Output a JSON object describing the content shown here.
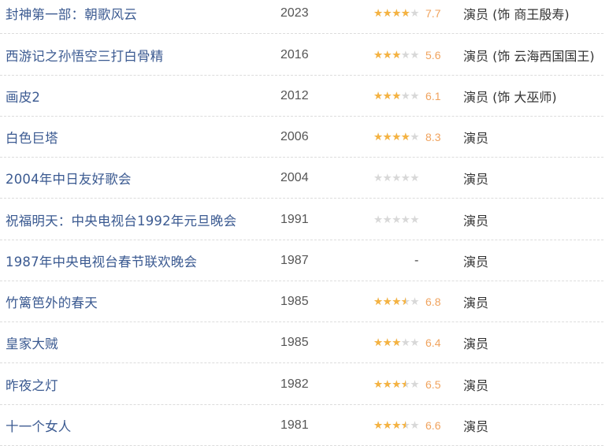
{
  "filmography": {
    "rows": [
      {
        "title": "封神第一部：朝歌风云",
        "year": "2023",
        "rating": 7.7,
        "score": "7.7",
        "role": "演员 (饰 商王殷寿)"
      },
      {
        "title": "西游记之孙悟空三打白骨精",
        "year": "2016",
        "rating": 5.6,
        "score": "5.6",
        "role": "演员 (饰 云海西国国王)"
      },
      {
        "title": "画皮2",
        "year": "2012",
        "rating": 6.1,
        "score": "6.1",
        "role": "演员 (饰 大巫师)"
      },
      {
        "title": "白色巨塔",
        "year": "2006",
        "rating": 8.3,
        "score": "8.3",
        "role": "演员"
      },
      {
        "title": "2004年中日友好歌会",
        "year": "2004",
        "rating": 0,
        "score": "",
        "role": "演员"
      },
      {
        "title": "祝福明天：中央电视台1992年元旦晚会",
        "year": "1991",
        "rating": 0,
        "score": "",
        "role": "演员"
      },
      {
        "title": "1987年中央电视台春节联欢晚会",
        "year": "1987",
        "rating": null,
        "score": "",
        "no_rating": "-",
        "role": "演员"
      },
      {
        "title": "竹篱笆外的春天",
        "year": "1985",
        "rating": 6.8,
        "score": "6.8",
        "role": "演员"
      },
      {
        "title": "皇家大贼",
        "year": "1985",
        "rating": 6.4,
        "score": "6.4",
        "role": "演员"
      },
      {
        "title": "昨夜之灯",
        "year": "1982",
        "rating": 6.5,
        "score": "6.5",
        "role": "演员"
      },
      {
        "title": "十一个女人",
        "year": "1981",
        "rating": 6.6,
        "score": "6.6",
        "role": "演员"
      }
    ]
  },
  "colors": {
    "title": "#3b5a91",
    "star_filled": "#f5b342",
    "star_empty": "#d8d8d8",
    "score": "#f0a35e"
  },
  "icons": {
    "star": "star-icon"
  }
}
